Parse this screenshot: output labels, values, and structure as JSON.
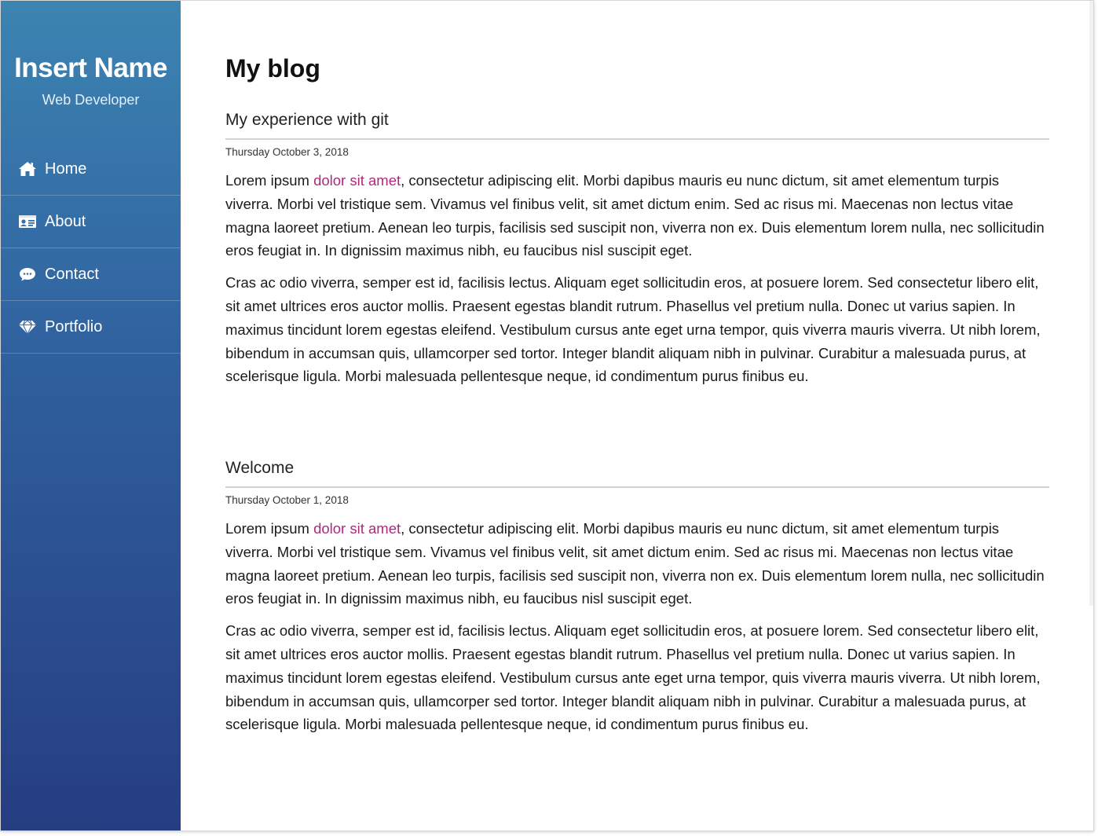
{
  "sidebar": {
    "name": "Insert Name",
    "role": "Web Developer",
    "nav": [
      {
        "label": "Home",
        "icon": "home-icon"
      },
      {
        "label": "About",
        "icon": "id-card-icon"
      },
      {
        "label": "Contact",
        "icon": "chat-bubble-icon"
      },
      {
        "label": "Portfolio",
        "icon": "diamond-icon"
      }
    ],
    "gradient_top": "#3c84b2",
    "gradient_bottom": "#263d82"
  },
  "main": {
    "title": "My blog",
    "link_color": "#b0277f",
    "posts": [
      {
        "title": "My experience with git",
        "date": "Thursday October 3, 2018",
        "p1_before": "Lorem ipsum ",
        "p1_link": "dolor sit amet",
        "p1_after": ", consectetur adipiscing elit. Morbi dapibus mauris eu nunc dictum, sit amet elementum turpis viverra. Morbi vel tristique sem. Vivamus vel finibus velit, sit amet dictum enim. Sed ac risus mi. Maecenas non lectus vitae magna laoreet pretium. Aenean leo turpis, facilisis sed suscipit non, viverra non ex. Duis elementum lorem nulla, nec sollicitudin eros feugiat in. In dignissim maximus nibh, eu faucibus nisl suscipit eget.",
        "p2": "Cras ac odio viverra, semper est id, facilisis lectus. Aliquam eget sollicitudin eros, at posuere lorem. Sed consectetur libero elit, sit amet ultrices eros auctor mollis. Praesent egestas blandit rutrum. Phasellus vel pretium nulla. Donec ut varius sapien. In maximus tincidunt lorem egestas eleifend. Vestibulum cursus ante eget urna tempor, quis viverra mauris viverra. Ut nibh lorem, bibendum in accumsan quis, ullamcorper sed tortor. Integer blandit aliquam nibh in pulvinar. Curabitur a malesuada purus, at scelerisque ligula. Morbi malesuada pellentesque neque, id condimentum purus finibus eu."
      },
      {
        "title": "Welcome",
        "date": "Thursday October 1, 2018",
        "p1_before": "Lorem ipsum ",
        "p1_link": "dolor sit amet",
        "p1_after": ", consectetur adipiscing elit. Morbi dapibus mauris eu nunc dictum, sit amet elementum turpis viverra. Morbi vel tristique sem. Vivamus vel finibus velit, sit amet dictum enim. Sed ac risus mi. Maecenas non lectus vitae magna laoreet pretium. Aenean leo turpis, facilisis sed suscipit non, viverra non ex. Duis elementum lorem nulla, nec sollicitudin eros feugiat in. In dignissim maximus nibh, eu faucibus nisl suscipit eget.",
        "p2": "Cras ac odio viverra, semper est id, facilisis lectus. Aliquam eget sollicitudin eros, at posuere lorem. Sed consectetur libero elit, sit amet ultrices eros auctor mollis. Praesent egestas blandit rutrum. Phasellus vel pretium nulla. Donec ut varius sapien. In maximus tincidunt lorem egestas eleifend. Vestibulum cursus ante eget urna tempor, quis viverra mauris viverra. Ut nibh lorem, bibendum in accumsan quis, ullamcorper sed tortor. Integer blandit aliquam nibh in pulvinar. Curabitur a malesuada purus, at scelerisque ligula. Morbi malesuada pellentesque neque, id condimentum purus finibus eu."
      }
    ]
  }
}
